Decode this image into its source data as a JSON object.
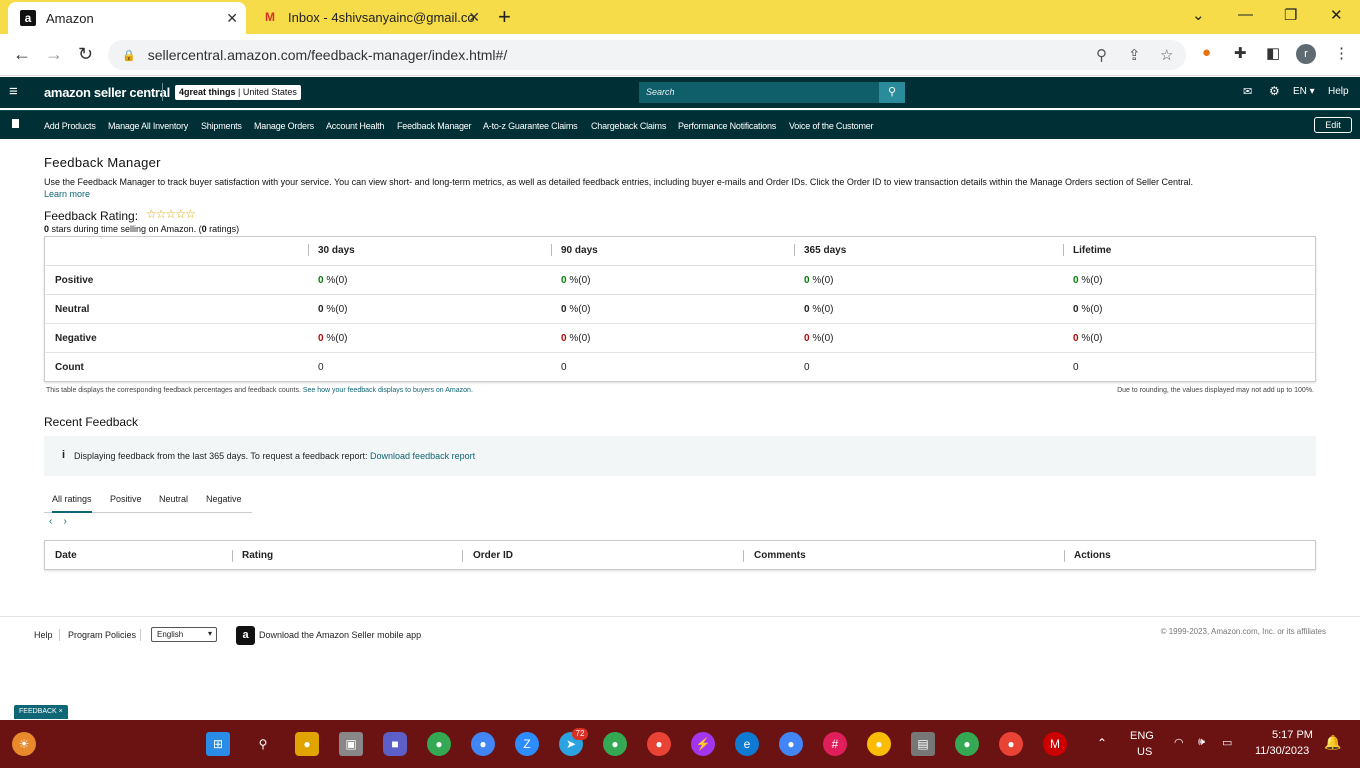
{
  "browser": {
    "tabs": [
      {
        "title": "Amazon",
        "favicon": "a"
      },
      {
        "title": "Inbox - 4shivsanyainc@gmail.co",
        "favicon": "M"
      }
    ],
    "url": "sellercentral.amazon.com/feedback-manager/index.html#/",
    "profile": "r"
  },
  "header": {
    "logo": "amazon seller central",
    "store_name": "4great things",
    "store_country": "United States",
    "search_placeholder": "Search",
    "lang": "EN",
    "help": "Help"
  },
  "nav": {
    "items": [
      "Add Products",
      "Manage All Inventory",
      "Shipments",
      "Manage Orders",
      "Account Health",
      "Feedback Manager",
      "A-to-z Guarantee Claims",
      "Chargeback Claims",
      "Performance Notifications",
      "Voice of the Customer"
    ],
    "edit": "Edit"
  },
  "page": {
    "title": "Feedback Manager",
    "description": "Use the Feedback Manager to track buyer satisfaction with your service. You can view short- and long-term metrics, as well as detailed feedback entries, including buyer e-mails and Order IDs. Click the Order ID to view transaction details within the Manage Orders section of Seller Central.",
    "learn_more": "Learn more",
    "rating_label": "Feedback Rating:",
    "stars": "☆☆☆☆☆",
    "rating_sub_bold": "0",
    "rating_sub_mid": " stars during time selling on Amazon. (",
    "rating_sub_bold2": "0",
    "rating_sub_end": " ratings)"
  },
  "feedback_table": {
    "headers": [
      "30 days",
      "90 days",
      "365 days",
      "Lifetime"
    ],
    "rows": [
      {
        "label": "Positive",
        "num": "0",
        "pct": " %(0)"
      },
      {
        "label": "Neutral",
        "num": "0",
        "pct": " %(0)"
      },
      {
        "label": "Negative",
        "num": "0",
        "pct": " %(0)"
      },
      {
        "label": "Count",
        "num": "0",
        "pct": ""
      }
    ],
    "note": "This table displays the corresponding feedback percentages and feedback counts.",
    "note_link": "See how your feedback displays to buyers on Amazon.",
    "rounding_note": "Due to rounding, the values displayed may not add up to 100%."
  },
  "recent": {
    "title": "Recent Feedback",
    "info": "Displaying feedback from the last 365 days. To request a feedback report:",
    "info_link": "Download feedback report",
    "tabs": [
      "All ratings",
      "Positive",
      "Neutral",
      "Negative"
    ],
    "columns": [
      "Date",
      "Rating",
      "Order ID",
      "Comments",
      "Actions"
    ]
  },
  "footer": {
    "help": "Help",
    "policies": "Program Policies",
    "language": "English",
    "app": "Download the Amazon Seller mobile app",
    "copyright": "© 1999-2023, Amazon.com, Inc. or its affiliates",
    "feedback_btn": "FEEDBACK ×"
  },
  "taskbar": {
    "lang_top": "ENG",
    "lang_bottom": "US",
    "time": "5:17 PM",
    "date": "11/30/2023",
    "telegram_badge": "72"
  }
}
